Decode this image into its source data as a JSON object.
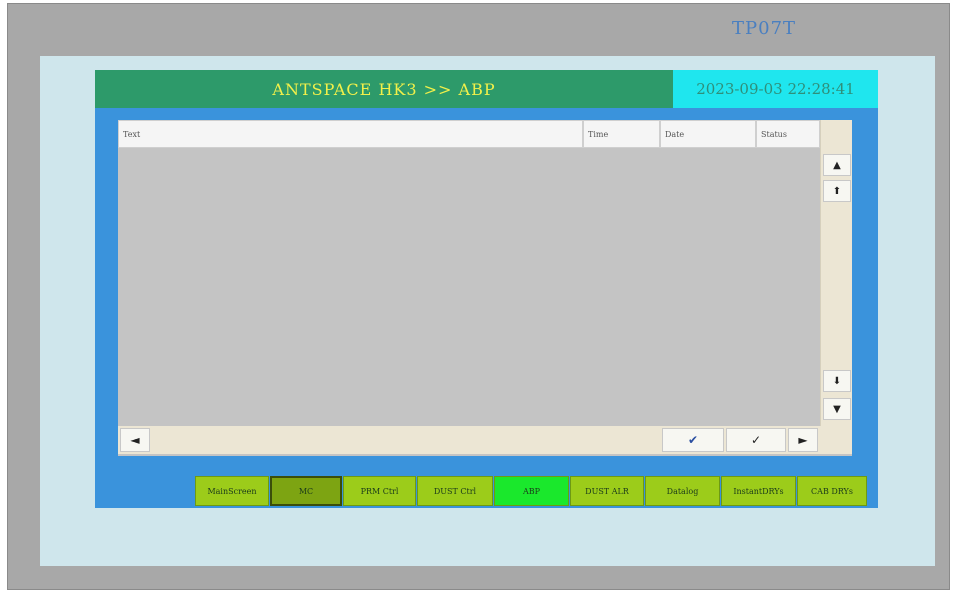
{
  "device": {
    "model": "TP07T"
  },
  "header": {
    "title": "ANTSPACE HK3 >> ABP",
    "datetime": "2023-09-03 22:28:41"
  },
  "alarm_table": {
    "columns": [
      "Text",
      "Time",
      "Date",
      "Status"
    ],
    "rows": []
  },
  "scroll": {
    "up": "▲",
    "page_up": "⬆",
    "page_down": "⬇",
    "down": "▼",
    "left": "◄",
    "right": "►",
    "ack_all": "✔",
    "ack": "✓"
  },
  "nav": {
    "items": [
      "MainScreen",
      "MC",
      "PRM Ctrl",
      "DUST Ctrl",
      "ABP",
      "DUST ALR",
      "Datalog",
      "InstantDRYs",
      "CAB DRYs"
    ],
    "active": "ABP",
    "pressed": "MC"
  },
  "colors": {
    "titlebar": "#2d9a6a",
    "title_text": "#f2f04a",
    "clock_bg": "#1fe6ee",
    "frame": "#3a93dc",
    "nav_button": "#9ccc1a",
    "nav_active": "#1ae82c"
  }
}
